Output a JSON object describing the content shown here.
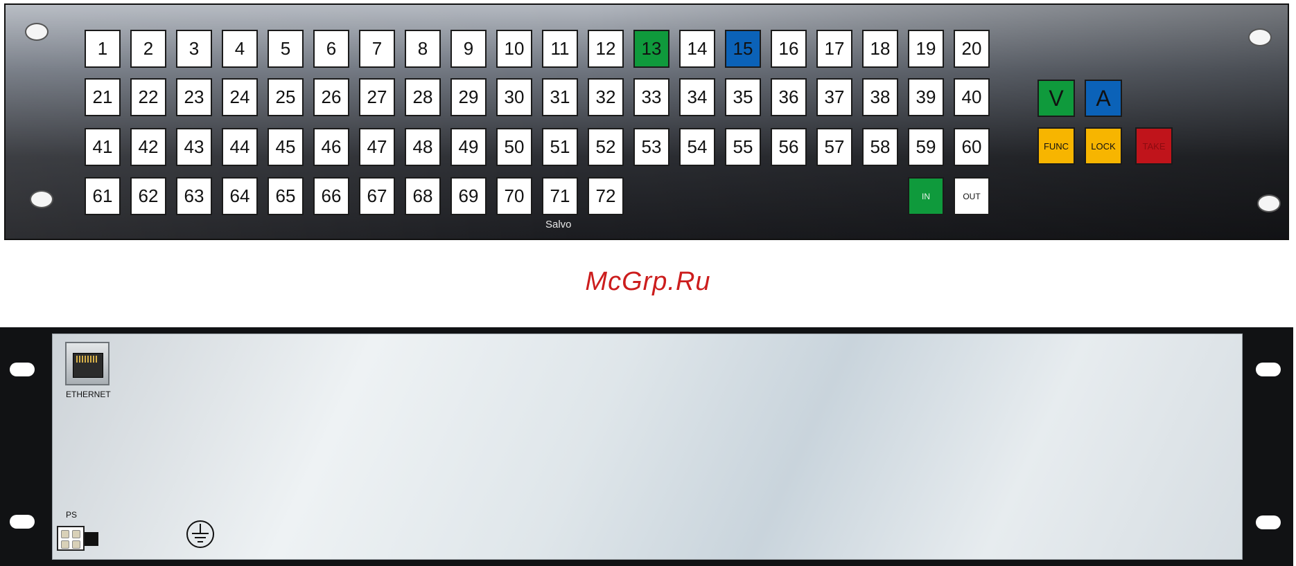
{
  "front_panel": {
    "keys_row1": [
      "1",
      "2",
      "3",
      "4",
      "5",
      "6",
      "7",
      "8",
      "9",
      "10",
      "11",
      "12",
      "13",
      "14",
      "15",
      "16",
      "17",
      "18",
      "19",
      "20"
    ],
    "keys_row2": [
      "21",
      "22",
      "23",
      "24",
      "25",
      "26",
      "27",
      "28",
      "29",
      "30",
      "31",
      "32",
      "33",
      "34",
      "35",
      "36",
      "37",
      "38",
      "39",
      "40"
    ],
    "keys_row3": [
      "41",
      "42",
      "43",
      "44",
      "45",
      "46",
      "47",
      "48",
      "49",
      "50",
      "51",
      "52",
      "53",
      "54",
      "55",
      "56",
      "57",
      "58",
      "59",
      "60"
    ],
    "keys_row4": [
      "61",
      "62",
      "63",
      "64",
      "65",
      "66",
      "67",
      "68",
      "69",
      "70",
      "71",
      "72"
    ],
    "highlight_green_key": "13",
    "highlight_blue_key": "15",
    "in_key": "IN",
    "out_key": "OUT",
    "salvo_label": "Salvo",
    "v_key": "V",
    "a_key": "A",
    "func_key": "FUNC",
    "lock_key": "LOCK",
    "take_key": "TAKE",
    "colors": {
      "green": "#0f9a3c",
      "blue": "#0b62b8",
      "yellow": "#f7b500",
      "red": "#c0141b"
    }
  },
  "watermark": "McGrp.Ru",
  "rear_panel": {
    "ethernet_label": "ETHERNET",
    "ps_label": "PS"
  }
}
